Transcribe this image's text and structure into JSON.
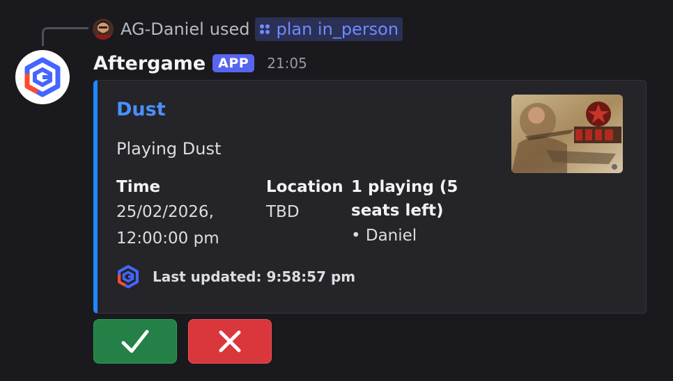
{
  "reply": {
    "username": "AG-Daniel",
    "used_text": "used",
    "command": "plan in_person",
    "avatar_icon": "user-avatar-icon",
    "command_icon": "slash-command-icon"
  },
  "message": {
    "bot_name": "Aftergame",
    "badge": "APP",
    "timestamp": "21:05",
    "avatar_icon": "aftergame-logo-icon",
    "accent_color": "#1e88ff"
  },
  "embed": {
    "title": "Dust",
    "description": "Playing Dust",
    "fields": [
      {
        "name": "Time",
        "value_lines": [
          "25/02/2026,",
          "12:00:00 pm"
        ]
      },
      {
        "name": "Location",
        "value_lines": [
          "TBD"
        ]
      },
      {
        "name_lines": [
          "1 playing (5",
          "seats left)"
        ],
        "value_lines": [
          "• Daniel"
        ]
      }
    ],
    "thumbnail_icon": "dust-boxart-thumbnail",
    "footer": {
      "icon": "aftergame-logo-icon",
      "text": "Last updated: 9:58:57 pm"
    }
  },
  "buttons": {
    "accept_icon": "checkmark-icon",
    "accept_color": "#248046",
    "decline_icon": "cross-icon",
    "decline_color": "#da373c"
  }
}
